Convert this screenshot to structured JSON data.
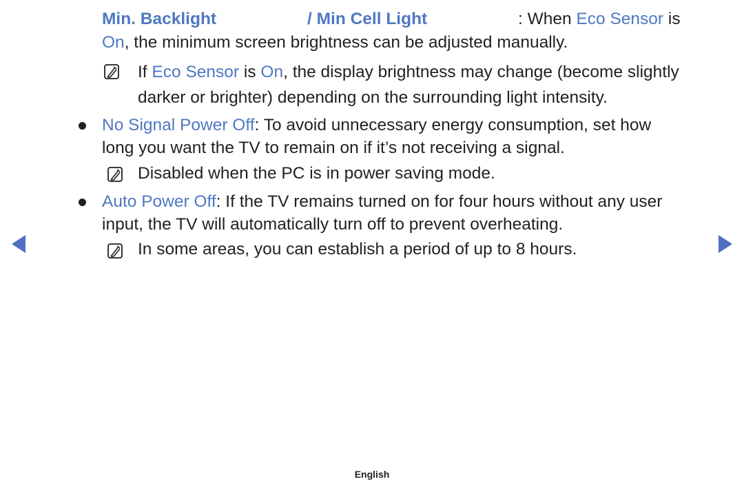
{
  "items": {
    "min_backlight": {
      "label_a": "Min. Backlight",
      "label_b": "/ Min Cell Light",
      "text_pre": ": When ",
      "eco_sensor": "Eco Sensor",
      "text_is": " is",
      "on": "On",
      "text_line2": ", the minimum screen brightness can be adjusted manually."
    },
    "note1": {
      "pre": "If ",
      "eco_sensor": "Eco Sensor",
      "is": " is ",
      "on": "On",
      "post": ", the display brightness may change (become slightly",
      "line2": "darker or brighter) depending on the surrounding light intensity."
    },
    "no_signal": {
      "label": "No Signal Power Off",
      "text": ": To avoid unnecessary energy consumption, set how",
      "line2": "long you want the TV to remain on if it’s not receiving a signal.",
      "note": "Disabled when the PC is in power saving mode."
    },
    "auto_power": {
      "label": "Auto Power Off",
      "text": ": If the TV remains turned on for four hours without any user",
      "line2": "input, the TV will automatically turn off to prevent overheating.",
      "note": "In some areas, you can establish a period of up to 8 hours."
    }
  },
  "nav": {
    "prev_icon": "triangle-left",
    "next_icon": "triangle-right"
  },
  "footer": {
    "language": "English"
  },
  "colors": {
    "highlight": "#4f78c2",
    "text": "#231f20",
    "arrow": "#4f6fc2"
  }
}
